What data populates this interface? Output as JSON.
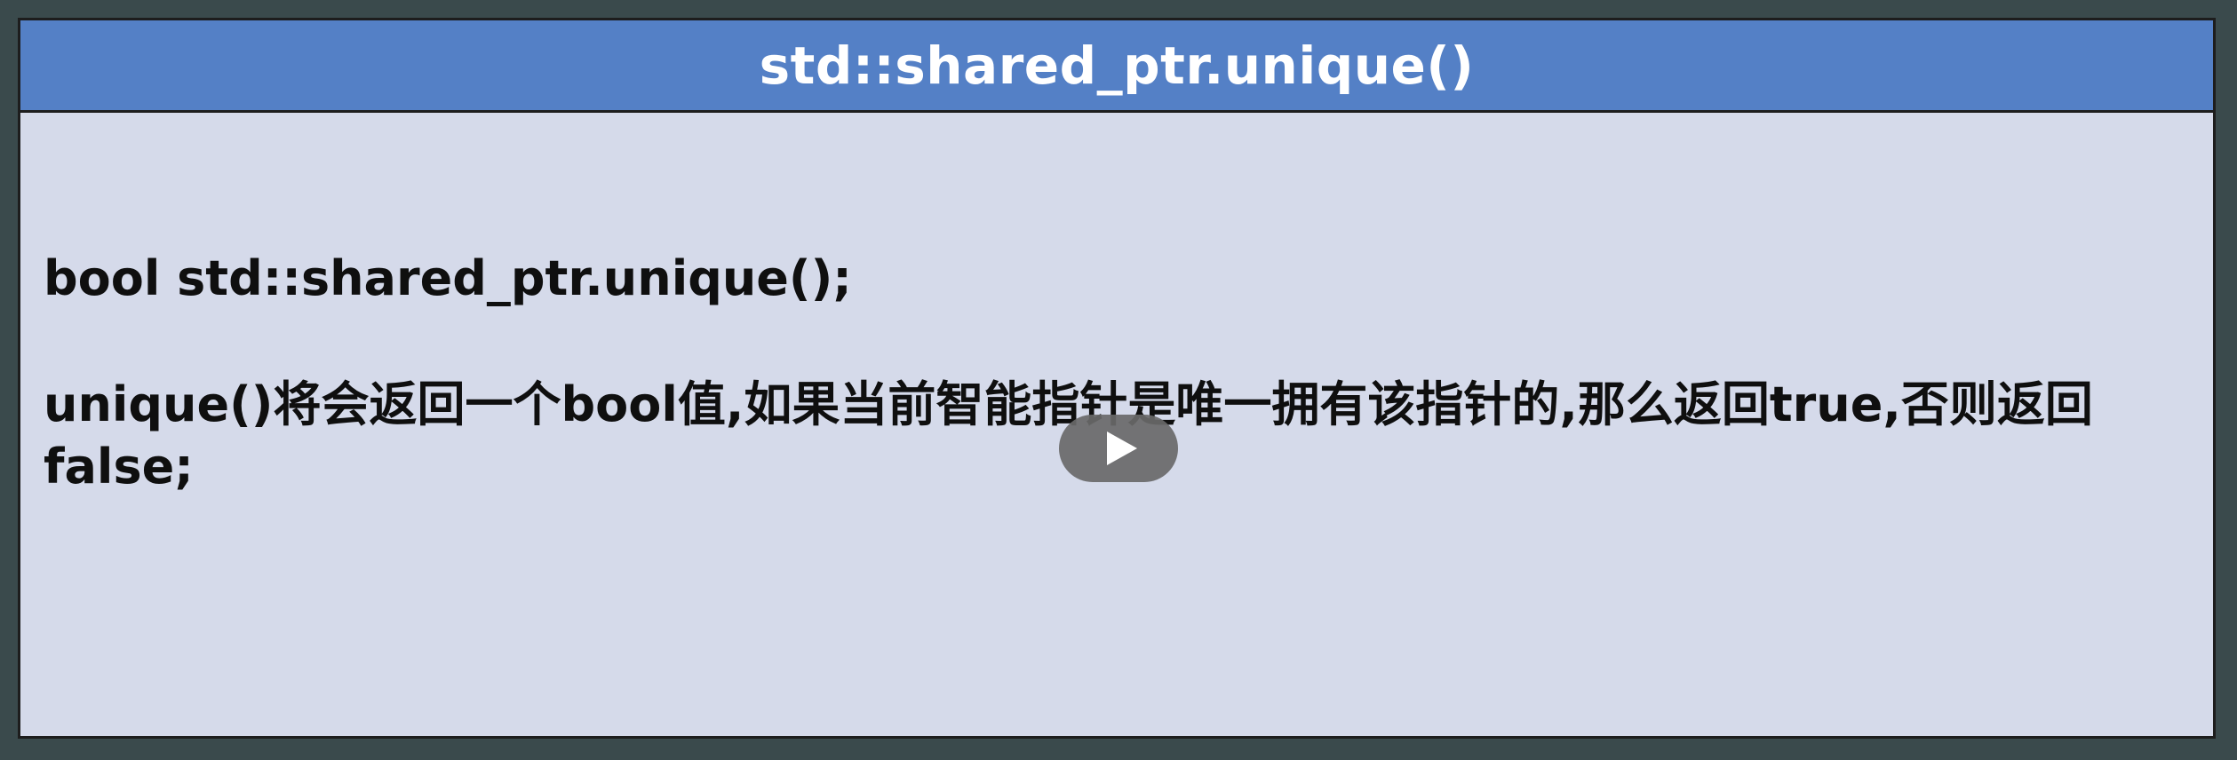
{
  "slide": {
    "title": "std::shared_ptr.unique()",
    "signature": "bool std::shared_ptr.unique();",
    "description": "unique()将会返回一个bool值,如果当前智能指针是唯一拥有该指针的,那么返回true,否则返回false;"
  },
  "player": {
    "play_icon": "play-icon"
  },
  "colors": {
    "title_bar": "#5480c6",
    "slide_background": "#d5daea",
    "page_background": "#3a4a4c",
    "text": "#0f0f0f",
    "title_text": "#ffffff"
  }
}
